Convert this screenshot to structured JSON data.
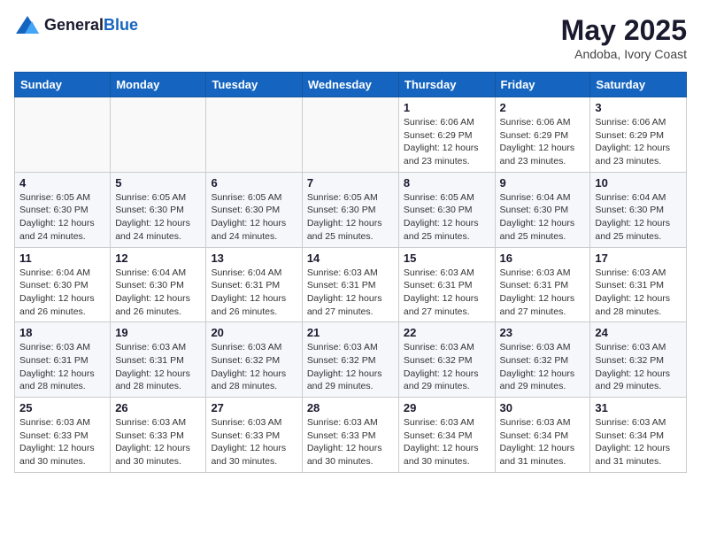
{
  "logo": {
    "general": "General",
    "blue": "Blue"
  },
  "title": {
    "month_year": "May 2025",
    "location": "Andoba, Ivory Coast"
  },
  "weekdays": [
    "Sunday",
    "Monday",
    "Tuesday",
    "Wednesday",
    "Thursday",
    "Friday",
    "Saturday"
  ],
  "weeks": [
    [
      {
        "day": "",
        "info": ""
      },
      {
        "day": "",
        "info": ""
      },
      {
        "day": "",
        "info": ""
      },
      {
        "day": "",
        "info": ""
      },
      {
        "day": "1",
        "info": "Sunrise: 6:06 AM\nSunset: 6:29 PM\nDaylight: 12 hours\nand 23 minutes."
      },
      {
        "day": "2",
        "info": "Sunrise: 6:06 AM\nSunset: 6:29 PM\nDaylight: 12 hours\nand 23 minutes."
      },
      {
        "day": "3",
        "info": "Sunrise: 6:06 AM\nSunset: 6:29 PM\nDaylight: 12 hours\nand 23 minutes."
      }
    ],
    [
      {
        "day": "4",
        "info": "Sunrise: 6:05 AM\nSunset: 6:30 PM\nDaylight: 12 hours\nand 24 minutes."
      },
      {
        "day": "5",
        "info": "Sunrise: 6:05 AM\nSunset: 6:30 PM\nDaylight: 12 hours\nand 24 minutes."
      },
      {
        "day": "6",
        "info": "Sunrise: 6:05 AM\nSunset: 6:30 PM\nDaylight: 12 hours\nand 24 minutes."
      },
      {
        "day": "7",
        "info": "Sunrise: 6:05 AM\nSunset: 6:30 PM\nDaylight: 12 hours\nand 25 minutes."
      },
      {
        "day": "8",
        "info": "Sunrise: 6:05 AM\nSunset: 6:30 PM\nDaylight: 12 hours\nand 25 minutes."
      },
      {
        "day": "9",
        "info": "Sunrise: 6:04 AM\nSunset: 6:30 PM\nDaylight: 12 hours\nand 25 minutes."
      },
      {
        "day": "10",
        "info": "Sunrise: 6:04 AM\nSunset: 6:30 PM\nDaylight: 12 hours\nand 25 minutes."
      }
    ],
    [
      {
        "day": "11",
        "info": "Sunrise: 6:04 AM\nSunset: 6:30 PM\nDaylight: 12 hours\nand 26 minutes."
      },
      {
        "day": "12",
        "info": "Sunrise: 6:04 AM\nSunset: 6:30 PM\nDaylight: 12 hours\nand 26 minutes."
      },
      {
        "day": "13",
        "info": "Sunrise: 6:04 AM\nSunset: 6:31 PM\nDaylight: 12 hours\nand 26 minutes."
      },
      {
        "day": "14",
        "info": "Sunrise: 6:03 AM\nSunset: 6:31 PM\nDaylight: 12 hours\nand 27 minutes."
      },
      {
        "day": "15",
        "info": "Sunrise: 6:03 AM\nSunset: 6:31 PM\nDaylight: 12 hours\nand 27 minutes."
      },
      {
        "day": "16",
        "info": "Sunrise: 6:03 AM\nSunset: 6:31 PM\nDaylight: 12 hours\nand 27 minutes."
      },
      {
        "day": "17",
        "info": "Sunrise: 6:03 AM\nSunset: 6:31 PM\nDaylight: 12 hours\nand 28 minutes."
      }
    ],
    [
      {
        "day": "18",
        "info": "Sunrise: 6:03 AM\nSunset: 6:31 PM\nDaylight: 12 hours\nand 28 minutes."
      },
      {
        "day": "19",
        "info": "Sunrise: 6:03 AM\nSunset: 6:31 PM\nDaylight: 12 hours\nand 28 minutes."
      },
      {
        "day": "20",
        "info": "Sunrise: 6:03 AM\nSunset: 6:32 PM\nDaylight: 12 hours\nand 28 minutes."
      },
      {
        "day": "21",
        "info": "Sunrise: 6:03 AM\nSunset: 6:32 PM\nDaylight: 12 hours\nand 29 minutes."
      },
      {
        "day": "22",
        "info": "Sunrise: 6:03 AM\nSunset: 6:32 PM\nDaylight: 12 hours\nand 29 minutes."
      },
      {
        "day": "23",
        "info": "Sunrise: 6:03 AM\nSunset: 6:32 PM\nDaylight: 12 hours\nand 29 minutes."
      },
      {
        "day": "24",
        "info": "Sunrise: 6:03 AM\nSunset: 6:32 PM\nDaylight: 12 hours\nand 29 minutes."
      }
    ],
    [
      {
        "day": "25",
        "info": "Sunrise: 6:03 AM\nSunset: 6:33 PM\nDaylight: 12 hours\nand 30 minutes."
      },
      {
        "day": "26",
        "info": "Sunrise: 6:03 AM\nSunset: 6:33 PM\nDaylight: 12 hours\nand 30 minutes."
      },
      {
        "day": "27",
        "info": "Sunrise: 6:03 AM\nSunset: 6:33 PM\nDaylight: 12 hours\nand 30 minutes."
      },
      {
        "day": "28",
        "info": "Sunrise: 6:03 AM\nSunset: 6:33 PM\nDaylight: 12 hours\nand 30 minutes."
      },
      {
        "day": "29",
        "info": "Sunrise: 6:03 AM\nSunset: 6:34 PM\nDaylight: 12 hours\nand 30 minutes."
      },
      {
        "day": "30",
        "info": "Sunrise: 6:03 AM\nSunset: 6:34 PM\nDaylight: 12 hours\nand 31 minutes."
      },
      {
        "day": "31",
        "info": "Sunrise: 6:03 AM\nSunset: 6:34 PM\nDaylight: 12 hours\nand 31 minutes."
      }
    ]
  ]
}
